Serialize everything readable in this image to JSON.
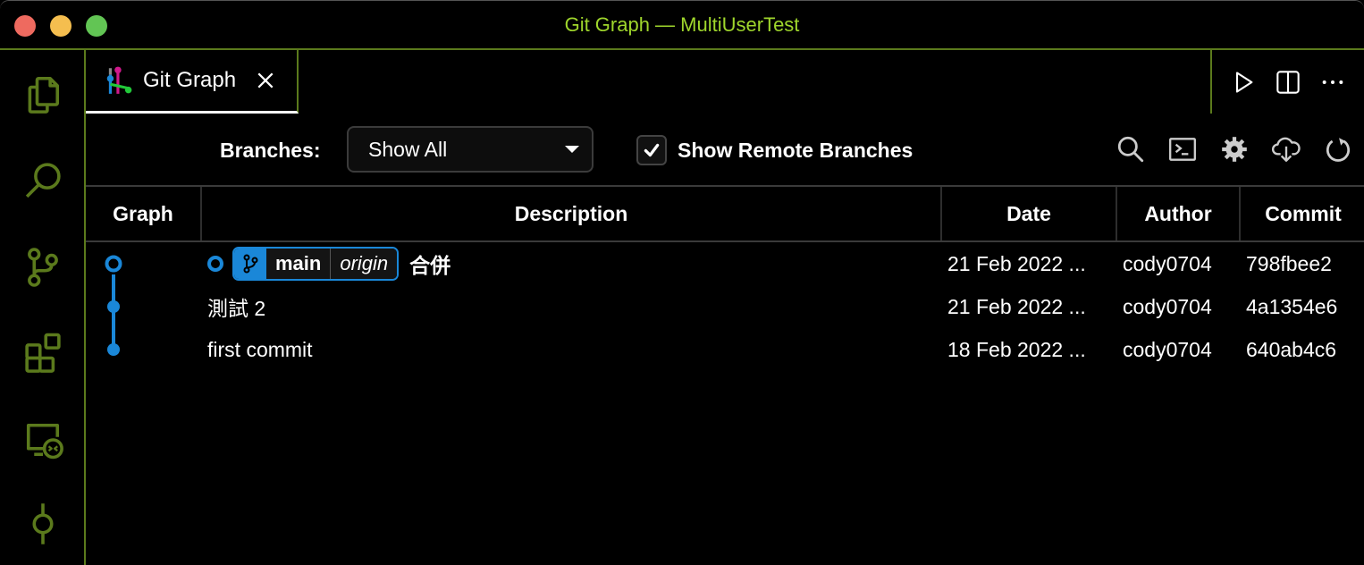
{
  "window": {
    "title": "Git Graph — MultiUserTest",
    "accent_color": "#9fd62c",
    "border_color": "#5b7a1c"
  },
  "activity_bar": {
    "items": [
      {
        "id": "explorer",
        "icon": "files-icon"
      },
      {
        "id": "search",
        "icon": "search-icon"
      },
      {
        "id": "source-control",
        "icon": "source-control-icon"
      },
      {
        "id": "extensions",
        "icon": "extensions-icon"
      },
      {
        "id": "remote-explorer",
        "icon": "remote-explorer-icon"
      },
      {
        "id": "timeline",
        "icon": "git-commit-icon"
      }
    ]
  },
  "tabs": [
    {
      "label": "Git Graph",
      "icon": "git-graph-icon",
      "active": true
    }
  ],
  "editor_actions": [
    {
      "name": "run",
      "icon": "play-icon"
    },
    {
      "name": "split-editor",
      "icon": "split-editor-icon"
    },
    {
      "name": "more-actions",
      "icon": "ellipsis-icon"
    }
  ],
  "controls": {
    "branches_label": "Branches:",
    "branches_value": "Show All",
    "show_remote_label": "Show Remote Branches",
    "show_remote_checked": true,
    "toolbar_icons": [
      {
        "name": "find",
        "icon": "search-icon"
      },
      {
        "name": "terminal",
        "icon": "terminal-icon"
      },
      {
        "name": "settings",
        "icon": "gear-icon"
      },
      {
        "name": "fetch",
        "icon": "cloud-download-icon"
      },
      {
        "name": "refresh",
        "icon": "refresh-icon"
      }
    ]
  },
  "table": {
    "columns": {
      "graph": "Graph",
      "description": "Description",
      "date": "Date",
      "author": "Author",
      "commit": "Commit"
    },
    "graph_color": "#1a87d8",
    "rows": [
      {
        "head": true,
        "refs": {
          "branch": "main",
          "remote": "origin"
        },
        "description": "合併",
        "date": "21 Feb 2022 ...",
        "author": "cody0704",
        "commit": "798fbee2"
      },
      {
        "head": false,
        "description": "測試 2",
        "date": "21 Feb 2022 ...",
        "author": "cody0704",
        "commit": "4a1354e6"
      },
      {
        "head": false,
        "description": "first commit",
        "date": "18 Feb 2022 ...",
        "author": "cody0704",
        "commit": "640ab4c6"
      }
    ]
  }
}
